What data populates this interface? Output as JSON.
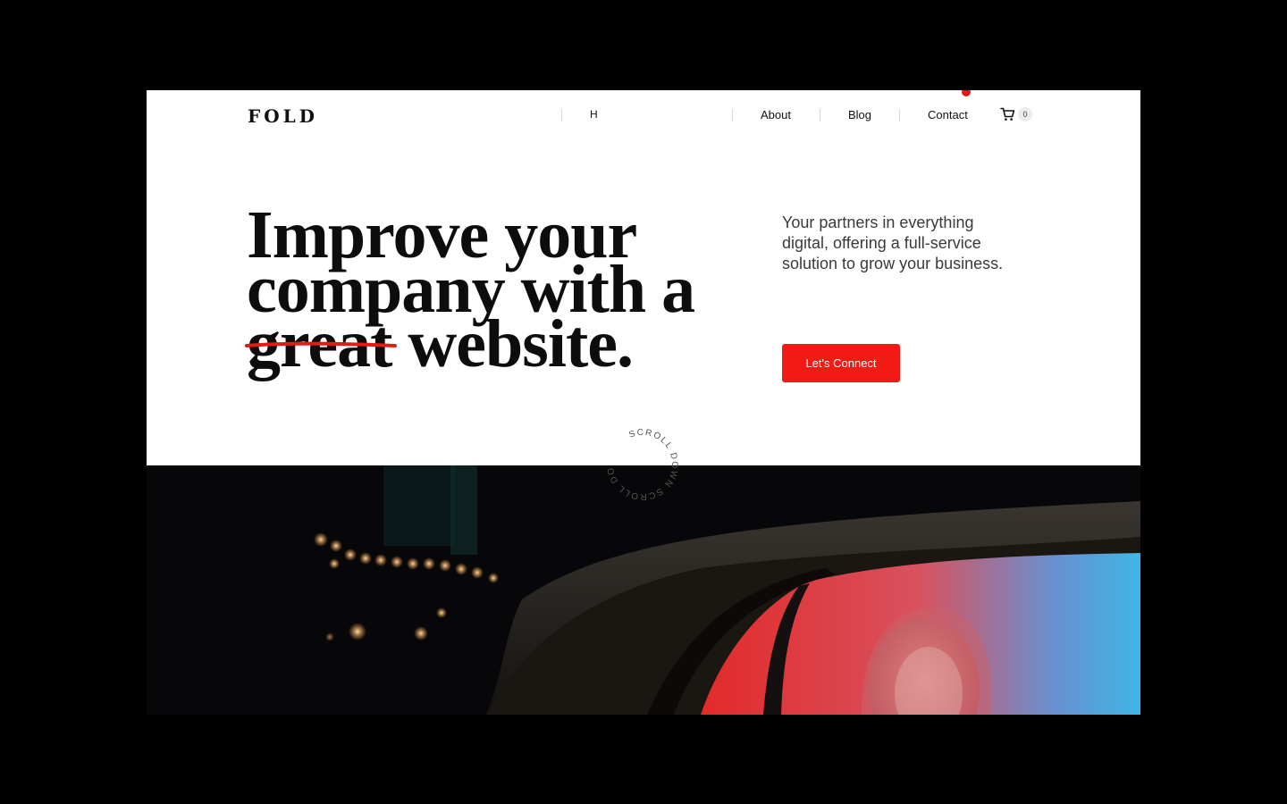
{
  "header": {
    "logo": "FOLD",
    "nav": {
      "home_label": "H",
      "about_label": "About",
      "blog_label": "Blog",
      "contact_label": "Contact"
    },
    "cart_count": "0",
    "cart_icon": "cart-icon"
  },
  "hero": {
    "headline_line1": "Improve your",
    "headline_line2": "company with a",
    "headline_strike_word": "great",
    "headline_end": " website.",
    "tagline": "Your partners in everything digital, offering a full-service solution to grow your business.",
    "cta_label": "Let's Connect",
    "scroll_text": "SCROLL DOWN SCROLL DOWN"
  },
  "colors": {
    "accent": "#f11a14",
    "text": "#0d0d0d",
    "background": "#ffffff"
  }
}
